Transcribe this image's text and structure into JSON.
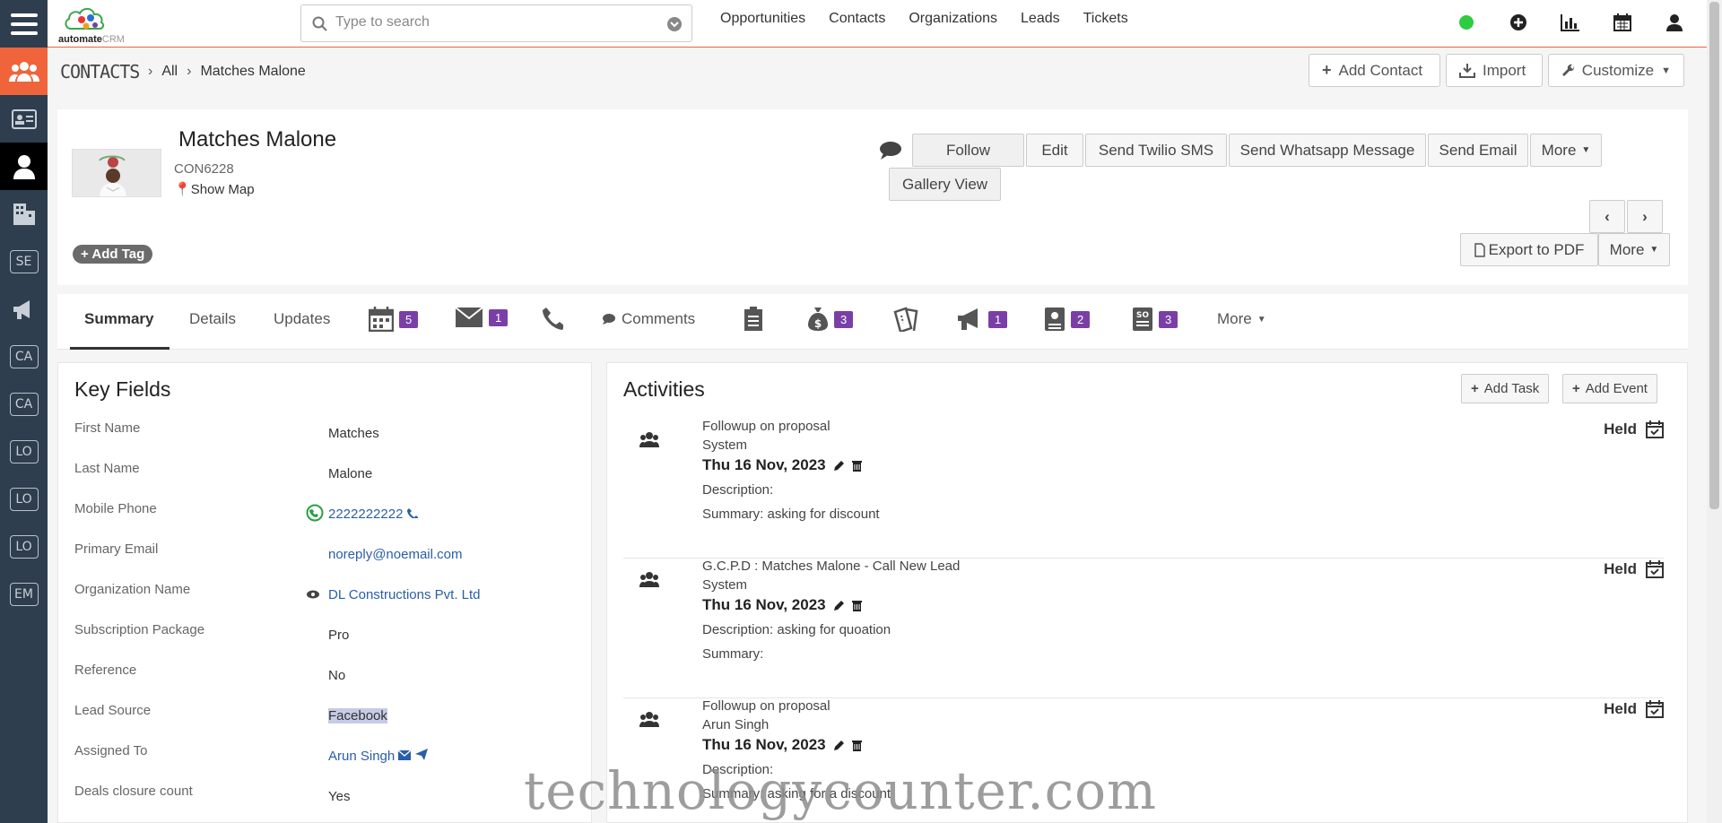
{
  "app": {
    "logo_text": "automate",
    "logo_suffix": "CRM"
  },
  "search": {
    "placeholder": "Type to search"
  },
  "topnav": [
    "Opportunities",
    "Contacts",
    "Organizations",
    "Leads",
    "Tickets"
  ],
  "sidebar": {
    "boxes": [
      "SE",
      "CA",
      "CA",
      "LO",
      "LO",
      "LO",
      "EM"
    ]
  },
  "breadcrumb": {
    "module": "CONTACTS",
    "filter": "All",
    "record": "Matches Malone"
  },
  "header_buttons": {
    "add": "Add Contact",
    "import": "Import",
    "customize": "Customize"
  },
  "record": {
    "name": "Matches Malone",
    "id": "CON6228",
    "show_map": "Show Map",
    "add_tag": "Add Tag"
  },
  "actions": {
    "follow": "Follow",
    "edit": "Edit",
    "sms": "Send Twilio SMS",
    "whatsapp": "Send Whatsapp Message",
    "email": "Send Email",
    "more": "More",
    "gallery": "Gallery View",
    "export": "Export to PDF",
    "more2": "More"
  },
  "tabs": {
    "summary": "Summary",
    "details": "Details",
    "updates": "Updates",
    "comments": "Comments",
    "more": "More",
    "badges": {
      "calendar": "5",
      "mail": "1",
      "deals": "3",
      "campaign": "1",
      "quotes": "2",
      "sales_orders": "3"
    }
  },
  "key_fields": {
    "title": "Key Fields",
    "rows": [
      {
        "label": "First Name",
        "value": "Matches"
      },
      {
        "label": "Last Name",
        "value": "Malone"
      },
      {
        "label": "Mobile Phone",
        "value": "2222222222"
      },
      {
        "label": "Primary Email",
        "value": "noreply@noemail.com"
      },
      {
        "label": "Organization Name",
        "value": "DL Constructions Pvt. Ltd"
      },
      {
        "label": "Subscription Package",
        "value": "Pro"
      },
      {
        "label": "Reference",
        "value": "No"
      },
      {
        "label": "Lead Source",
        "value": "Facebook"
      },
      {
        "label": "Assigned To",
        "value": "Arun Singh"
      },
      {
        "label": "Deals closure count",
        "value": "Yes"
      }
    ]
  },
  "activities": {
    "title": "Activities",
    "add_task": "Add Task",
    "add_event": "Add Event",
    "items": [
      {
        "subject": "Followup on proposal",
        "owner": "System",
        "date": "Thu 16 Nov, 2023",
        "description": "Description:",
        "summary": "Summary: asking for discount",
        "status": "Held"
      },
      {
        "subject": "G.C.P.D : Matches Malone - Call New Lead",
        "owner": "System",
        "date": "Thu 16 Nov, 2023",
        "description": "Description: asking for quoation",
        "summary": "Summary:",
        "status": "Held"
      },
      {
        "subject": "Followup on proposal",
        "owner": "Arun Singh",
        "date": "Thu 16 Nov, 2023",
        "description": "Description:",
        "summary": "Summary: asking for a discount",
        "status": "Held"
      }
    ]
  },
  "watermark": "technologycounter.com"
}
